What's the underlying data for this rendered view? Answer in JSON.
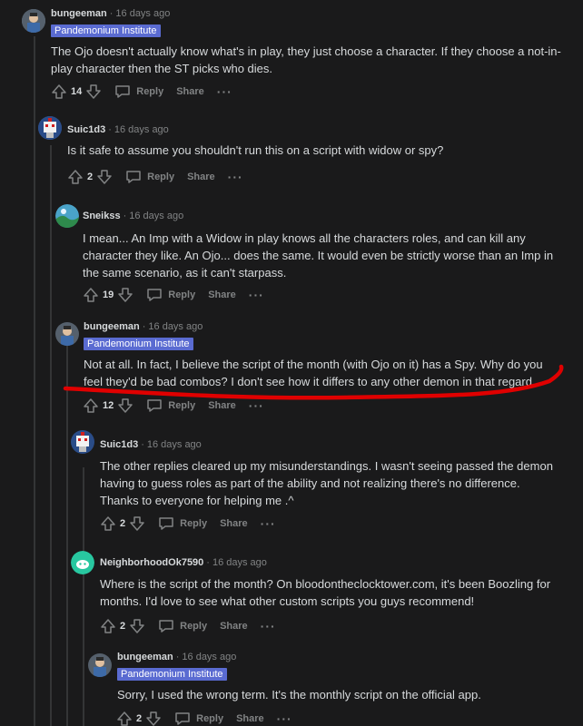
{
  "flair_text": "Pandemonium Institute",
  "labels": {
    "reply": "Reply",
    "share": "Share",
    "more": "···"
  },
  "colors": {
    "background": "#1a1a1b",
    "flair": "#5a6bd1",
    "annotation": "#e00000",
    "meta": "#818384"
  },
  "comments": [
    {
      "user": "bungeeman",
      "time": "16 days ago",
      "has_flair": true,
      "avatar": "user-avatar-icon",
      "text": "The Ojo doesn't actually know what's in play, they just choose a character. If they choose a not-in-play character then the ST picks who dies.",
      "score": "14"
    },
    {
      "user": "Suic1d3",
      "time": "16 days ago",
      "has_flair": false,
      "avatar": "robot-avatar-icon",
      "text": "Is it safe to assume you shouldn't run this on a script with widow or spy?",
      "score": "2"
    },
    {
      "user": "Sneikss",
      "time": "16 days ago",
      "has_flair": false,
      "avatar": "landscape-avatar-icon",
      "text": "I mean... An Imp with a Widow in play knows all the characters roles, and can kill any character they like. An Ojo... does the same. It would even be strictly worse than an Imp in the same scenario, as it can't starpass.",
      "score": "19"
    },
    {
      "user": "bungeeman",
      "time": "16 days ago",
      "has_flair": true,
      "avatar": "user-avatar-icon",
      "text": "Not at all. In fact, I believe the script of the month (with Ojo on it) has a Spy. Why do you feel they'd be bad combos? I don't see how it differs to any other demon in that regard.",
      "score": "12"
    },
    {
      "user": "Suic1d3",
      "time": "16 days ago",
      "has_flair": false,
      "avatar": "robot-avatar-icon",
      "text": "The other replies cleared up my misunderstandings. I wasn't seeing passed the demon having to guess roles as part of the ability and not realizing there's no difference. Thanks to everyone for helping me .^",
      "score": "2"
    },
    {
      "user": "NeighborhoodOk7590",
      "time": "16 days ago",
      "has_flair": false,
      "avatar": "snoo-avatar-icon",
      "text": "Where is the script of the month? On bloodontheclocktower.com, it's been Boozling for months. I'd love to see what other custom scripts you guys recommend!",
      "score": "2"
    },
    {
      "user": "bungeeman",
      "time": "16 days ago",
      "has_flair": true,
      "avatar": "user-avatar-icon",
      "text": "Sorry, I used the wrong term. It's the monthly script on the official app.",
      "score": "2"
    }
  ]
}
